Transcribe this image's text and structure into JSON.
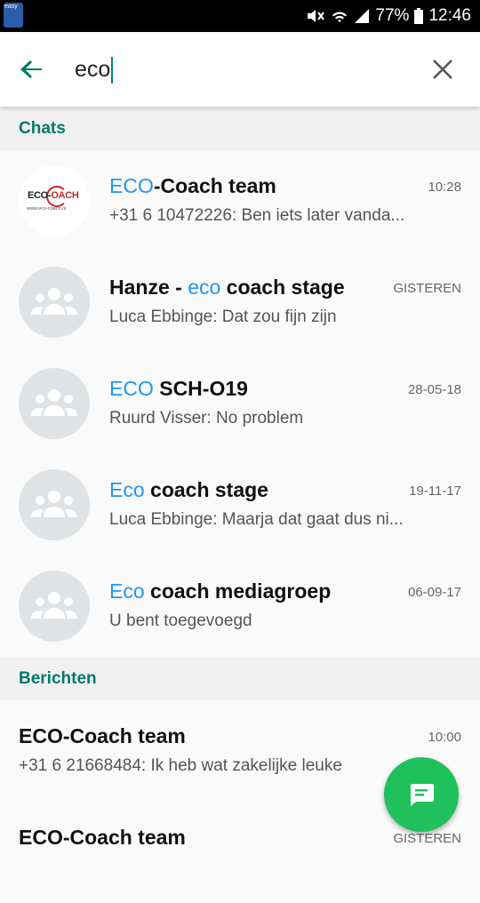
{
  "statusbar": {
    "app_badge": "easy",
    "battery": "77%",
    "time": "12:46"
  },
  "search": {
    "query": "eco"
  },
  "sections": {
    "chats": "Chats",
    "messages": "Berichten"
  },
  "chats": [
    {
      "highlight": "ECO",
      "rest": "-Coach team",
      "preview": "+31 6 10472226: Ben iets later vanda...",
      "time": "10:28",
      "avatar": "eco-coach-logo"
    },
    {
      "prefix": "Hanze - ",
      "highlight": "eco",
      "rest": " coach stage",
      "preview": "Luca Ebbinge: Dat zou fijn zijn",
      "time": "GISTEREN",
      "avatar": "group-icon"
    },
    {
      "highlight": "ECO",
      "rest": " SCH-O19",
      "preview": "Ruurd Visser: No problem",
      "time": "28-05-18",
      "avatar": "group-icon"
    },
    {
      "highlight": "Eco",
      "rest": " coach stage",
      "preview": "Luca Ebbinge: Maarja dat gaat dus ni...",
      "time": "19-11-17",
      "avatar": "group-icon"
    },
    {
      "highlight": "Eco",
      "rest": " coach mediagroep",
      "preview": "U bent toegevoegd",
      "time": "06-09-17",
      "avatar": "group-icon"
    }
  ],
  "logo": {
    "brand_left": "ECO-",
    "brand_right": "OACH",
    "url": "www.eco-coach.nl"
  },
  "messages": [
    {
      "title": "ECO-Coach team",
      "preview": "+31 6 21668484: Ik heb wat zakelijke leuke",
      "time": "10:00"
    },
    {
      "title": "ECO-Coach team",
      "preview": "",
      "time": "GISTEREN"
    }
  ],
  "colors": {
    "accent": "#00796b",
    "highlight": "#2196f3",
    "fab": "#1fc15c"
  }
}
